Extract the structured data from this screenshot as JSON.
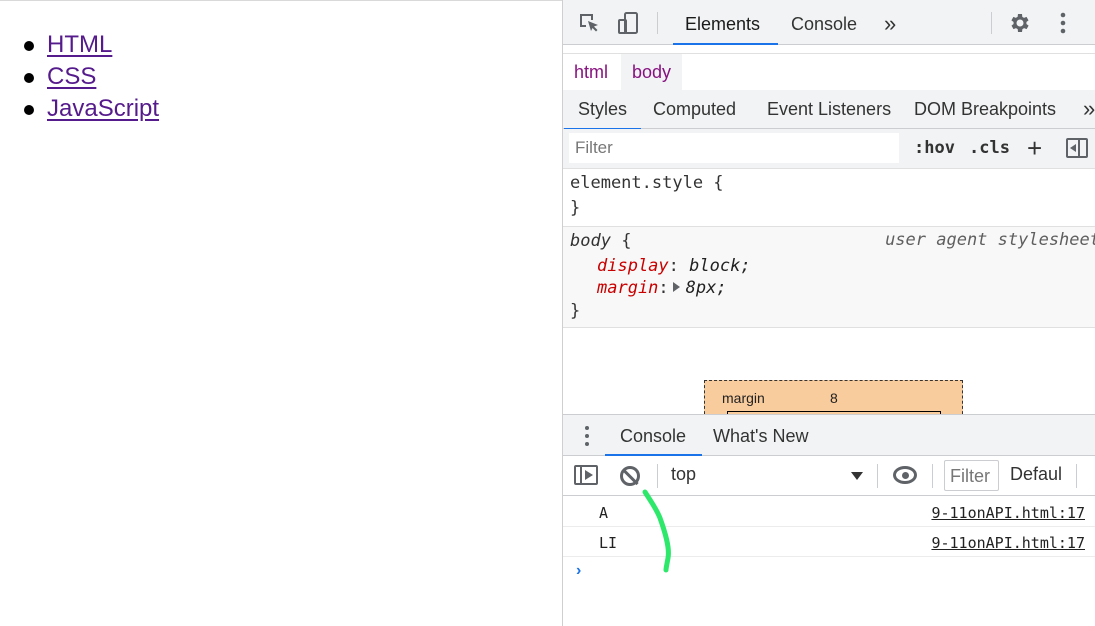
{
  "page": {
    "links": [
      "HTML",
      "CSS",
      "JavaScript"
    ]
  },
  "devtools": {
    "tabs": [
      "Elements",
      "Console"
    ],
    "more_tabs_glyph": "»",
    "breadcrumbs": [
      "html",
      "body"
    ],
    "subtabs": [
      "Styles",
      "Computed",
      "Event Listeners",
      "DOM Breakpoints"
    ],
    "filter_placeholder": "Filter",
    "hov_label": ":hov",
    "cls_label": ".cls",
    "element_style": {
      "selector": "element.style {",
      "close": "}"
    },
    "body_rule": {
      "selector": "body",
      "open": " {",
      "source": "user agent stylesheet",
      "declarations": [
        {
          "name": "display",
          "value": "block;"
        },
        {
          "name": "margin",
          "value": "8px;"
        }
      ],
      "close": "}"
    },
    "box_model": {
      "label": "margin",
      "value": "8"
    },
    "drawer_tabs": [
      "Console",
      "What's New"
    ],
    "console": {
      "context": "top",
      "filter_placeholder": "Filter",
      "levels": "Defaul",
      "messages": [
        {
          "text": "A",
          "source": "9-11onAPI.html:17"
        },
        {
          "text": "LI",
          "source": "9-11onAPI.html:17"
        }
      ],
      "prompt": "›"
    }
  },
  "annotation": {
    "color": "#2ee86b"
  }
}
